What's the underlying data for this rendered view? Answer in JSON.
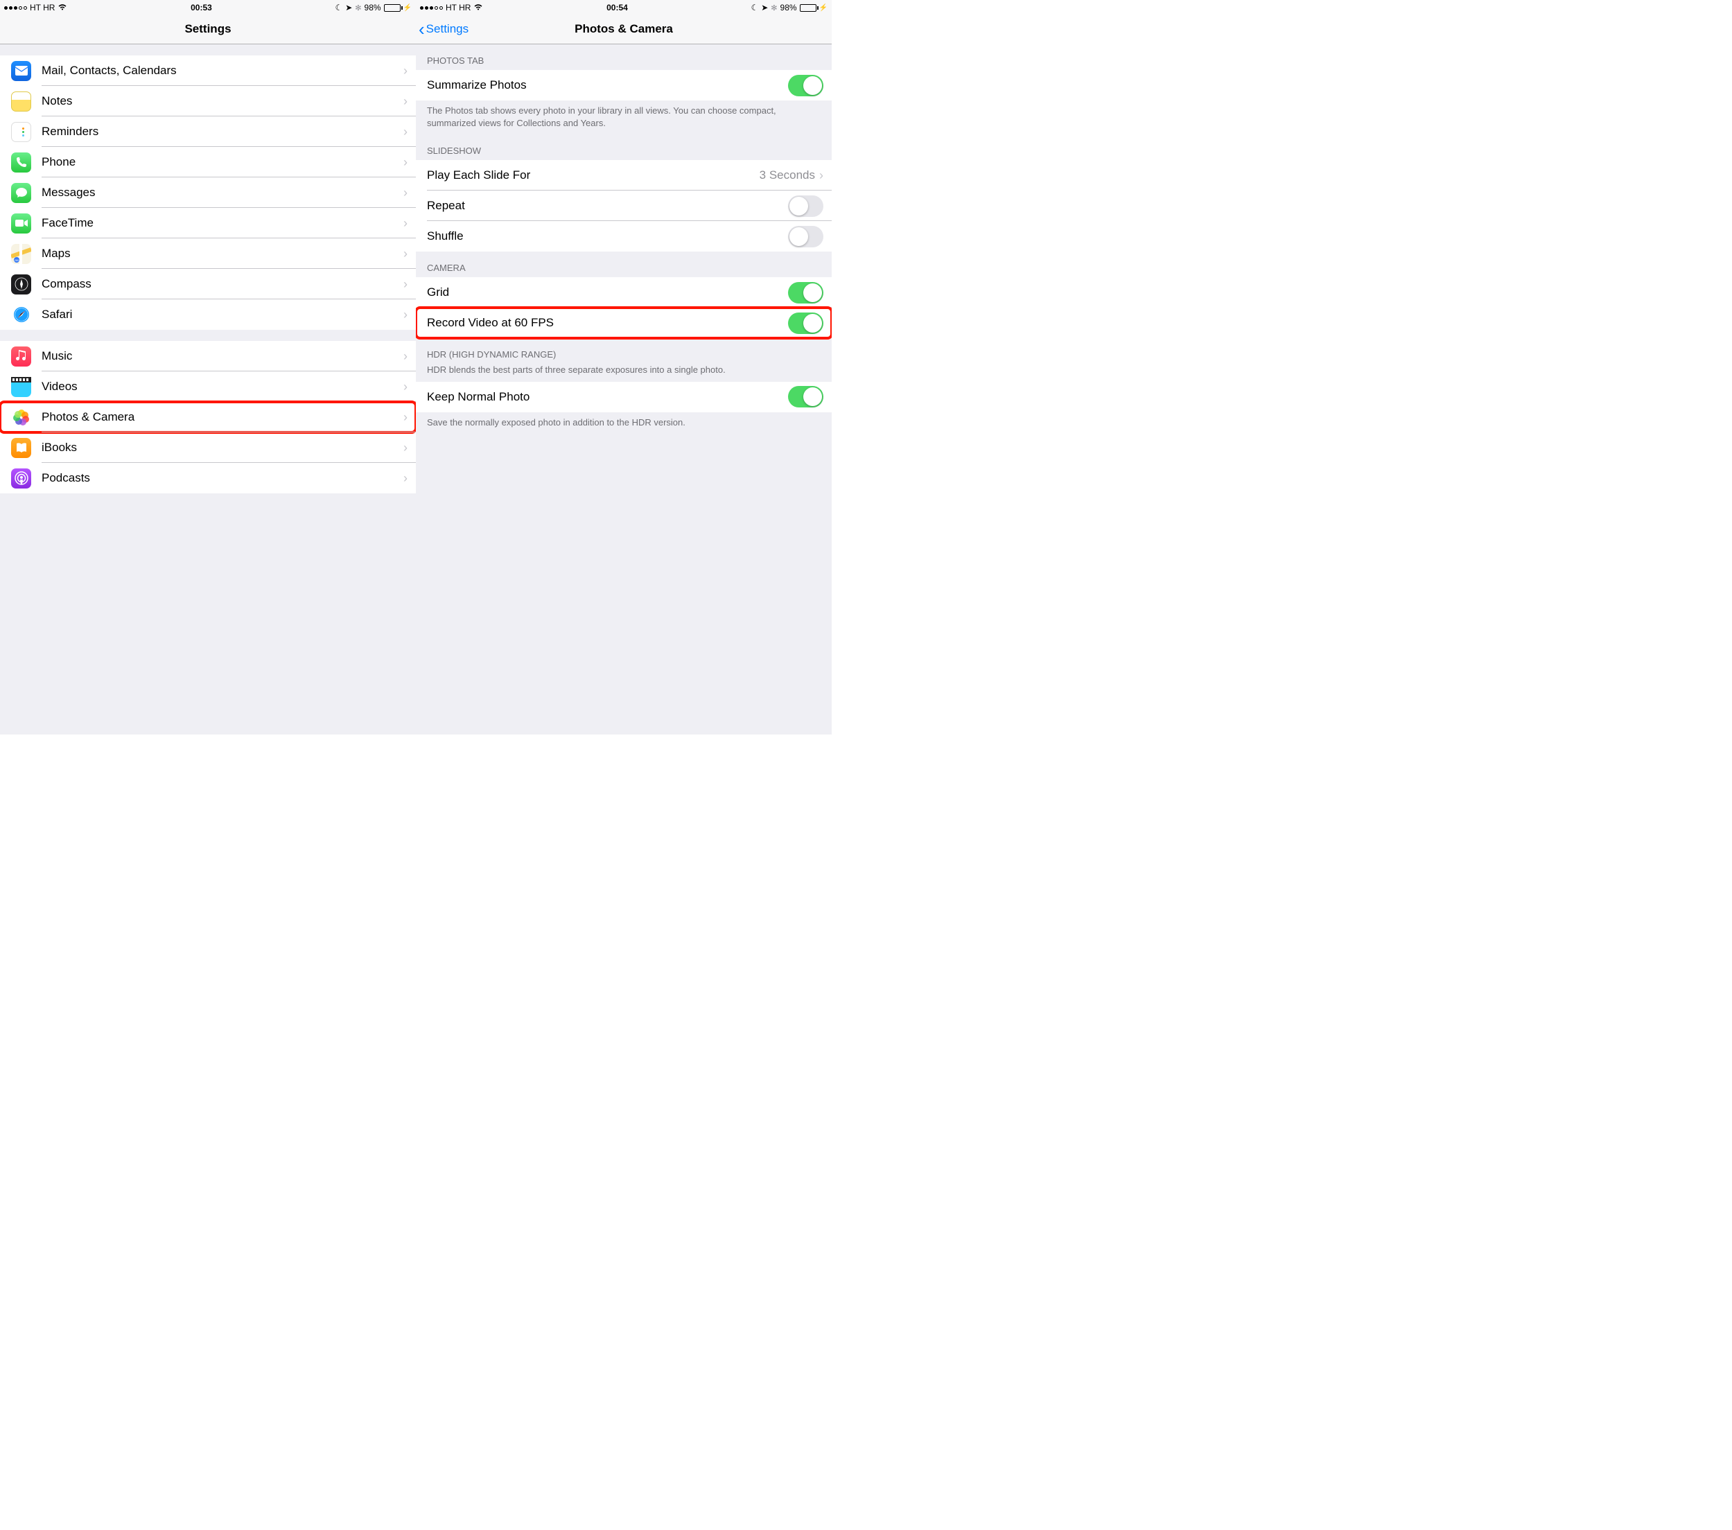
{
  "left": {
    "status": {
      "carrier": "HT HR",
      "time": "00:53",
      "battery": "98%"
    },
    "title": "Settings",
    "items": [
      {
        "icon": "mail",
        "label": "Mail, Contacts, Calendars"
      },
      {
        "icon": "notes",
        "label": "Notes"
      },
      {
        "icon": "reminders",
        "label": "Reminders"
      },
      {
        "icon": "phone",
        "label": "Phone"
      },
      {
        "icon": "messages",
        "label": "Messages"
      },
      {
        "icon": "facetime",
        "label": "FaceTime"
      },
      {
        "icon": "maps",
        "label": "Maps"
      },
      {
        "icon": "compass",
        "label": "Compass"
      },
      {
        "icon": "safari",
        "label": "Safari"
      }
    ],
    "items2": [
      {
        "icon": "music",
        "label": "Music"
      },
      {
        "icon": "videos",
        "label": "Videos"
      },
      {
        "icon": "photos",
        "label": "Photos & Camera",
        "highlight": true
      },
      {
        "icon": "ibooks",
        "label": "iBooks"
      },
      {
        "icon": "podcasts",
        "label": "Podcasts"
      }
    ]
  },
  "right": {
    "status": {
      "carrier": "HT HR",
      "time": "00:54",
      "battery": "98%"
    },
    "back": "Settings",
    "title": "Photos & Camera",
    "sections": {
      "photosTab": {
        "header": "PHOTOS TAB",
        "summarize": "Summarize Photos",
        "footer": "The Photos tab shows every photo in your library in all views. You can choose compact, summarized views for Collections and Years."
      },
      "slideshow": {
        "header": "SLIDESHOW",
        "playEach": "Play Each Slide For",
        "playValue": "3 Seconds",
        "repeat": "Repeat",
        "shuffle": "Shuffle"
      },
      "camera": {
        "header": "CAMERA",
        "grid": "Grid",
        "record60": "Record Video at 60 FPS"
      },
      "hdr": {
        "header": "HDR (HIGH DYNAMIC RANGE)",
        "desc": "HDR blends the best parts of three separate exposures into a single photo.",
        "keepNormal": "Keep Normal Photo",
        "footer": "Save the normally exposed photo in addition to the HDR version."
      }
    }
  }
}
